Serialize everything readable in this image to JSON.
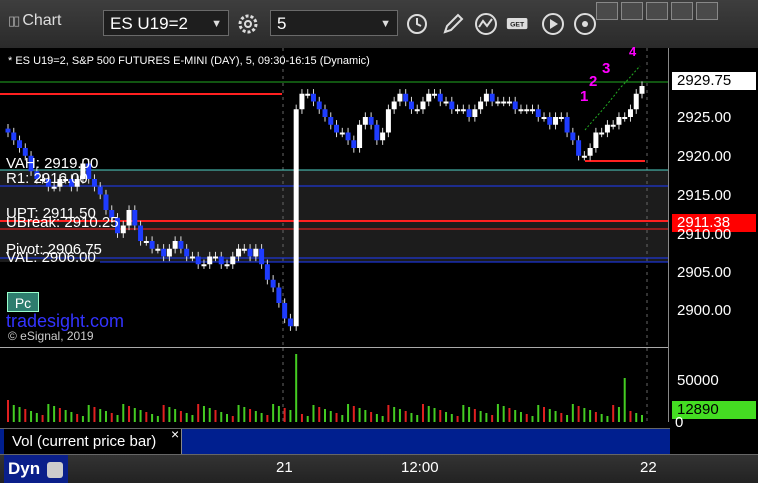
{
  "window": {
    "title": "Chart"
  },
  "toolbar": {
    "symbol": "ES U19=2",
    "interval": "5"
  },
  "chart_header": "* ES U19=2, S&P 500 FUTURES E-MINI (DAY), 5, 09:30-16:15 (Dynamic)",
  "levels": {
    "vah": "VAH: 2919.00",
    "r1": "R1: 2916.00",
    "upt": "UPT: 2911.50",
    "ubreak": "UBreak: 2910.25",
    "pivot": "Pivot: 2906.75",
    "val": "VAL: 2906.00"
  },
  "price_axis": {
    "ticks": [
      "2925.00",
      "2920.00",
      "2915.00",
      "2910.00",
      "2905.00",
      "2900.00"
    ],
    "last_price": "2929.75",
    "marker_price": "2911.38"
  },
  "volume_axis": {
    "tick": "50000",
    "zero": "0",
    "last_volume": "12890"
  },
  "time_axis": [
    "21",
    "12:00",
    "22"
  ],
  "watermark": "tradesight.com",
  "copyright": "© eSignal, 2019",
  "pc_button": "Pc",
  "vol_legend": "Vol (current price bar)",
  "vol_close": "×",
  "bottom_label": "Dyn",
  "annotations": [
    "1",
    "2",
    "3",
    "4"
  ],
  "colors": {
    "down_candle": "#1e3cff",
    "up_candle": "#ffffff",
    "last_price_tag": "#ffffff",
    "marker_tag": "#ff0000",
    "volume_tag": "#44dd22",
    "annotation": "#ff00ff"
  }
}
